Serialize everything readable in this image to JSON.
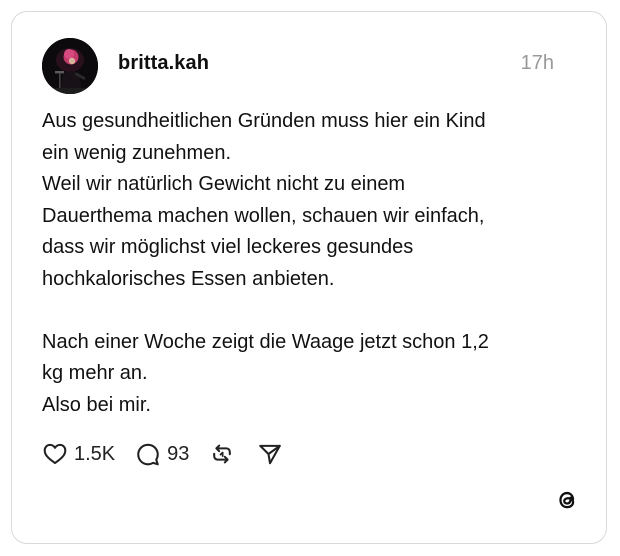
{
  "post": {
    "username": "britta.kah",
    "timestamp": "17h",
    "body_lines": [
      "Aus gesundheitlichen Gründen muss hier ein Kind",
      "ein wenig zunehmen.",
      "Weil wir natürlich Gewicht nicht zu einem",
      "Dauerthema machen wollen, schauen wir einfach,",
      "dass wir möglichst viel leckeres gesundes",
      "hochkalorisches Essen anbieten.",
      "",
      "Nach einer Woche zeigt die Waage jetzt schon 1,2",
      "kg mehr an.",
      "Also bei mir."
    ]
  },
  "actions": {
    "like_count": "1.5K",
    "reply_count": "93",
    "like_icon": "heart-icon",
    "reply_icon": "speech-bubble-icon",
    "repost_icon": "repost-icon",
    "share_icon": "send-icon"
  },
  "brand": {
    "logo": "threads-logo-icon"
  },
  "colors": {
    "text": "#111111",
    "muted": "#999999",
    "border": "#d9d9d9",
    "background": "#ffffff"
  }
}
